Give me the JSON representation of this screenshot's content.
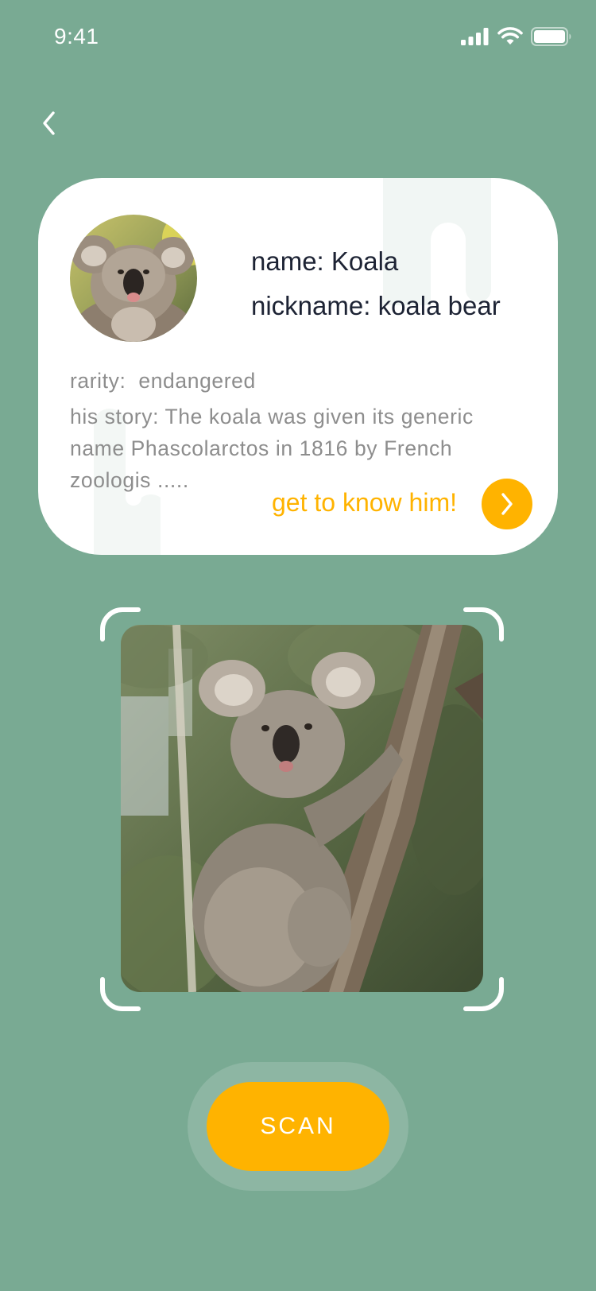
{
  "status_bar": {
    "time": "9:41",
    "signal_icon": "cellular-signal-icon",
    "wifi_icon": "wifi-icon",
    "battery_icon": "battery-icon"
  },
  "nav": {
    "back_icon": "chevron-left-icon"
  },
  "animal_card": {
    "avatar_image": "koala-portrait",
    "name": "name: Koala",
    "nickname": "nickname: koala bear",
    "rarity": "rarity:  endangered",
    "story": "his story: The koala was given its generic name Phascolarctos in 1816 by French zoologis .....",
    "link_label": "get to know him!",
    "link_icon": "chevron-right-icon"
  },
  "scanner": {
    "photo": "koala-on-tree-photo",
    "scan_label": "SCAN"
  },
  "colors": {
    "background": "#79aa93",
    "accent": "#ffb300",
    "card": "#ffffff",
    "title_text": "#1d2334",
    "body_text": "#8d8d8d"
  }
}
